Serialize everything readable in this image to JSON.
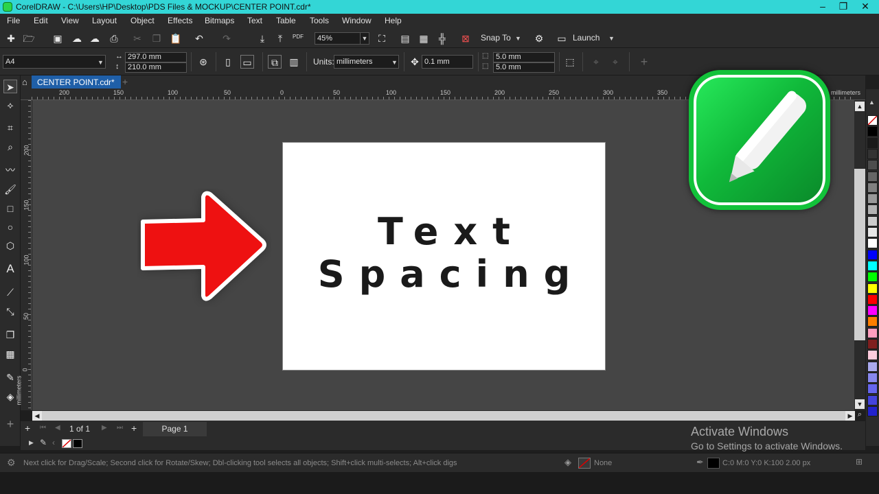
{
  "window": {
    "title": "CorelDRAW - C:\\Users\\HP\\Desktop\\PDS Files & MOCKUP\\CENTER POINT.cdr*",
    "minimize": "–",
    "restore": "❐",
    "close": "✕"
  },
  "menu": [
    "File",
    "Edit",
    "View",
    "Layout",
    "Object",
    "Effects",
    "Bitmaps",
    "Text",
    "Table",
    "Tools",
    "Window",
    "Help"
  ],
  "standard_toolbar": {
    "zoom": "45%",
    "snap_to": "Snap To",
    "launch": "Launch",
    "pdf": "PDF"
  },
  "property_bar": {
    "page_size": "A4",
    "width": "297.0 mm",
    "height": "210.0 mm",
    "units_label": "Units:",
    "units": "millimeters",
    "nudge": "0.1 mm",
    "dup_x": "5.0 mm",
    "dup_y": "5.0 mm"
  },
  "document_tab": "CENTER POINT.cdr*",
  "rulers": {
    "h_ticks": [
      "200",
      "150",
      "100",
      "50",
      "0",
      "50",
      "100",
      "150",
      "200",
      "250",
      "300",
      "350"
    ],
    "unit": "millimeters",
    "v_ticks": [
      "200",
      "150",
      "100",
      "50",
      "0"
    ],
    "v_unit": "millimeters"
  },
  "page_content": {
    "line1": "Text",
    "line2": "Spacing"
  },
  "page_nav": {
    "counter": "1 of 1",
    "page_tab": "Page 1"
  },
  "status": {
    "message": "Next click for Drag/Scale; Second click for Rotate/Skew; Dbl-clicking tool selects all objects; Shift+click multi-selects; Alt+click digs",
    "fill": "None",
    "outline": "C:0 M:0 Y:0 K:100  2.00 px"
  },
  "watermark": {
    "line1": "Activate Windows",
    "line2": "Go to Settings to activate Windows."
  },
  "palette": [
    "#ffffff",
    "#000000",
    "#1a1a1a",
    "#333333",
    "#4d4d4d",
    "#666666",
    "#808080",
    "#999999",
    "#b3b3b3",
    "#cccccc",
    "#e6e6e6",
    "#ffffff",
    "#0000ff",
    "#00ffff",
    "#00ff00",
    "#ffff00",
    "#ff0000",
    "#ff00ff",
    "#ff7f00",
    "#ff9fbf",
    "#7f1f1f",
    "#ffccdd",
    "#aaaaee",
    "#8888ee",
    "#6666ee",
    "#4444dd",
    "#2222cc"
  ],
  "colors": {
    "titlebar": "#33d6d6",
    "accent_tab": "#1f5fa8",
    "arrow": "#ee1111",
    "badge_green": "#12c23a"
  }
}
